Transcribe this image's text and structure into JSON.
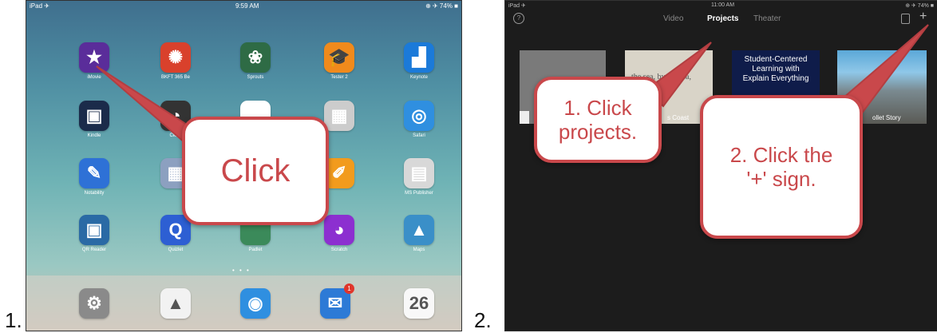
{
  "step1_label": "1.",
  "step2_label": "2.",
  "home": {
    "status_left": "iPad ✈",
    "status_center": "9:59 AM",
    "status_right": "⊕ ✈ 74% ■",
    "apps_row1": [
      {
        "icon": "star-icon",
        "glyph": "★",
        "label": "iMovie",
        "color": "#5a2d9a"
      },
      {
        "icon": "sun-dots-icon",
        "glyph": "✺",
        "label": "BKFT 365 Be",
        "color": "#d9412c"
      },
      {
        "icon": "flower-icon",
        "glyph": "❀",
        "label": "Sprouts",
        "color": "#2e6b45"
      },
      {
        "icon": "graduation-cap-icon",
        "glyph": "🎓",
        "label": "Tester 2",
        "color": "#f08a1c"
      },
      {
        "icon": "keynote-icon",
        "glyph": "▟",
        "label": "Keynote",
        "color": "#1b7ad9"
      }
    ],
    "apps_row2": [
      {
        "icon": "kindle-icon",
        "glyph": "▣",
        "label": "Kindle",
        "color": "#1b2b4a"
      },
      {
        "icon": "clock-icon",
        "glyph": "◔",
        "label": "Clock",
        "color": "#333333"
      },
      {
        "icon": "notes-icon",
        "glyph": "▤",
        "label": "",
        "color": "#ffffff"
      },
      {
        "icon": "newspaper-icon",
        "glyph": "▦",
        "label": "",
        "color": "#cccccc"
      },
      {
        "icon": "safari-icon",
        "glyph": "◎",
        "label": "Safari",
        "color": "#2f8fe0"
      }
    ],
    "apps_row3": [
      {
        "icon": "pencil-icon",
        "glyph": "✎",
        "label": "Notability",
        "color": "#2e71d6"
      },
      {
        "icon": "grid-icon",
        "glyph": "▦",
        "label": "",
        "color": "#8ca0c0"
      },
      {
        "icon": "app-icon",
        "glyph": "",
        "label": "",
        "color": "#3d6b7a"
      },
      {
        "icon": "pen-icon",
        "glyph": "✐",
        "label": "",
        "color": "#f29b1d"
      },
      {
        "icon": "document-icon",
        "glyph": "▤",
        "label": "MS Publisher",
        "color": "#d8d8d8"
      }
    ],
    "apps_row4": [
      {
        "icon": "qr-code-icon",
        "glyph": "▣",
        "label": "QR Reader",
        "color": "#2a6aa5"
      },
      {
        "icon": "q-letter-icon",
        "glyph": "Q",
        "label": "Quizlet",
        "color": "#2d5fd3"
      },
      {
        "icon": "app-icon",
        "glyph": "",
        "label": "Padlet",
        "color": "#3b8a5a"
      },
      {
        "icon": "cat-icon",
        "glyph": "◕",
        "label": "Scratch",
        "color": "#8c2fd0"
      },
      {
        "icon": "landscape-icon",
        "glyph": "▲",
        "label": "Maps",
        "color": "#3a8fc8"
      }
    ],
    "dock": [
      {
        "icon": "settings-gear-icon",
        "glyph": "⚙",
        "color": "#8a8a8a"
      },
      {
        "icon": "google-drive-icon",
        "glyph": "▲",
        "color": "#f2f2f2"
      },
      {
        "icon": "safari-compass-icon",
        "glyph": "◉",
        "color": "#2f8fe0"
      },
      {
        "icon": "mail-icon",
        "glyph": "✉",
        "color": "#2d7ad6",
        "badge": "1"
      },
      {
        "icon": "calendar-icon",
        "glyph": "26",
        "color": "#f8f8f8"
      }
    ],
    "callout_text": "Click"
  },
  "imovie": {
    "status_left": "iPad ✈",
    "status_center": "11:00 AM",
    "status_right": "⊕ ✈ 74% ■",
    "tabs": [
      "Video",
      "Projects",
      "Theater"
    ],
    "active_tab": "Projects",
    "thumb3_lines": [
      "Student-Centered",
      "Learning with",
      "Explain Everything"
    ],
    "thumb2_text": "the sea, by the sea,",
    "thumb2_caption": "s Coast",
    "thumb4_caption": "ollet Story",
    "callout1_lines": [
      "1. Click",
      "projects."
    ],
    "callout2_lines": [
      "2. Click the",
      "'+' sign."
    ]
  }
}
